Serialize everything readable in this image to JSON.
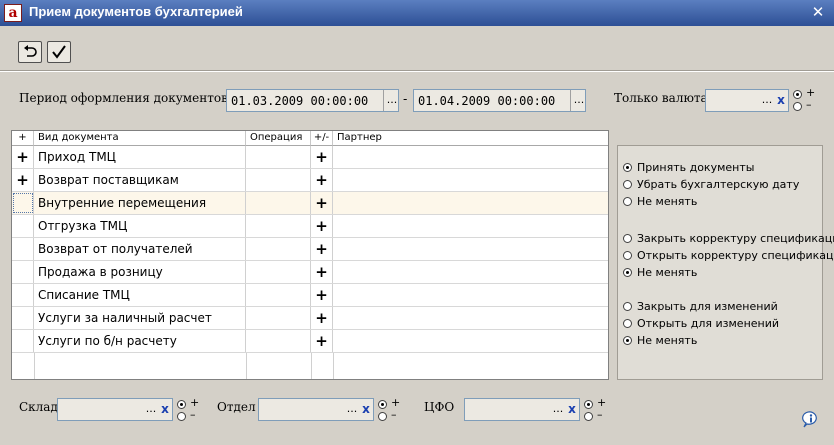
{
  "window": {
    "title": "Прием документов бухгалтерией",
    "logo_letter": "a"
  },
  "period": {
    "label": "Период оформления документов:",
    "from": "01.03.2009 00:00:00",
    "to": "01.04.2009 00:00:00",
    "dash": "-"
  },
  "currency": {
    "label": "Только валюта",
    "value": "",
    "plus": "+",
    "minus": "–"
  },
  "buttons": {
    "ellipsis": "...",
    "clear": "x"
  },
  "grid": {
    "headers": [
      "+",
      "Вид документа",
      "Операция",
      "+/-",
      "Партнер"
    ],
    "rows": [
      {
        "mark": "+",
        "name": "Приход ТМЦ",
        "operation": "",
        "pm": "+",
        "partner": ""
      },
      {
        "mark": "+",
        "name": "Возврат поставщикам",
        "operation": "",
        "pm": "+",
        "partner": ""
      },
      {
        "mark": "",
        "name": "Внутренние перемещения",
        "operation": "",
        "pm": "+",
        "partner": ""
      },
      {
        "mark": "",
        "name": "Отгрузка ТМЦ",
        "operation": "",
        "pm": "+",
        "partner": ""
      },
      {
        "mark": "",
        "name": "Возврат от получателей",
        "operation": "",
        "pm": "+",
        "partner": ""
      },
      {
        "mark": "",
        "name": "Продажа в розницу",
        "operation": "",
        "pm": "+",
        "partner": ""
      },
      {
        "mark": "",
        "name": "Списание ТМЦ",
        "operation": "",
        "pm": "+",
        "partner": ""
      },
      {
        "mark": "",
        "name": "Услуги за наличный расчет",
        "operation": "",
        "pm": "+",
        "partner": ""
      },
      {
        "mark": "",
        "name": "Услуги по б/н расчету",
        "operation": "",
        "pm": "+",
        "partner": ""
      }
    ]
  },
  "options": {
    "groups": [
      {
        "items": [
          "Принять документы",
          "Убрать бухгалтерскую дату",
          "Не менять"
        ],
        "selected": 0
      },
      {
        "items": [
          "Закрыть корректуру спецификаций",
          "Открыть корректуру спецификаций",
          "Не менять"
        ],
        "selected": 2
      },
      {
        "items": [
          "Закрыть для изменений",
          "Открыть для изменений",
          "Не менять"
        ],
        "selected": 2
      }
    ]
  },
  "filters": {
    "sklad": {
      "label": "Склад",
      "value": ""
    },
    "otdel": {
      "label": "Отдел",
      "value": ""
    },
    "cfo": {
      "label": "ЦФО",
      "value": ""
    }
  }
}
